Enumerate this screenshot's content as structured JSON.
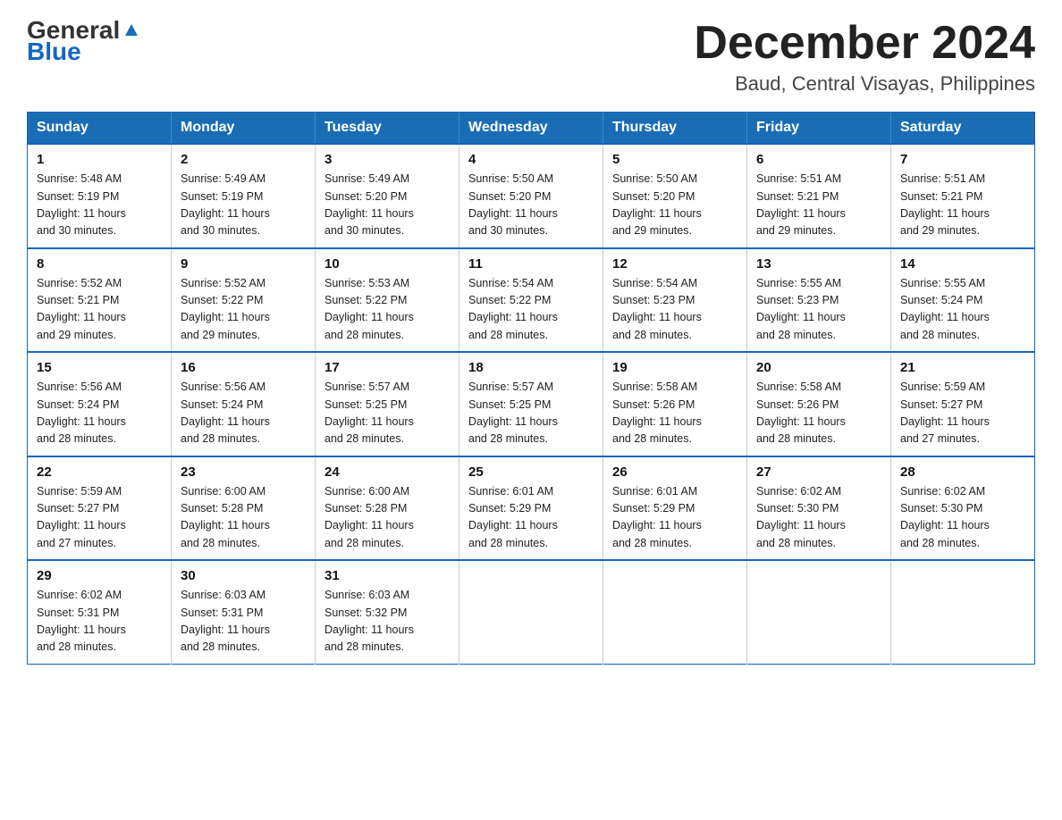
{
  "header": {
    "logo_general": "General",
    "logo_blue": "Blue",
    "month_title": "December 2024",
    "location": "Baud, Central Visayas, Philippines"
  },
  "days_of_week": [
    "Sunday",
    "Monday",
    "Tuesday",
    "Wednesday",
    "Thursday",
    "Friday",
    "Saturday"
  ],
  "weeks": [
    [
      {
        "day": "1",
        "sunrise": "5:48 AM",
        "sunset": "5:19 PM",
        "daylight": "11 hours and 30 minutes."
      },
      {
        "day": "2",
        "sunrise": "5:49 AM",
        "sunset": "5:19 PM",
        "daylight": "11 hours and 30 minutes."
      },
      {
        "day": "3",
        "sunrise": "5:49 AM",
        "sunset": "5:20 PM",
        "daylight": "11 hours and 30 minutes."
      },
      {
        "day": "4",
        "sunrise": "5:50 AM",
        "sunset": "5:20 PM",
        "daylight": "11 hours and 30 minutes."
      },
      {
        "day": "5",
        "sunrise": "5:50 AM",
        "sunset": "5:20 PM",
        "daylight": "11 hours and 29 minutes."
      },
      {
        "day": "6",
        "sunrise": "5:51 AM",
        "sunset": "5:21 PM",
        "daylight": "11 hours and 29 minutes."
      },
      {
        "day": "7",
        "sunrise": "5:51 AM",
        "sunset": "5:21 PM",
        "daylight": "11 hours and 29 minutes."
      }
    ],
    [
      {
        "day": "8",
        "sunrise": "5:52 AM",
        "sunset": "5:21 PM",
        "daylight": "11 hours and 29 minutes."
      },
      {
        "day": "9",
        "sunrise": "5:52 AM",
        "sunset": "5:22 PM",
        "daylight": "11 hours and 29 minutes."
      },
      {
        "day": "10",
        "sunrise": "5:53 AM",
        "sunset": "5:22 PM",
        "daylight": "11 hours and 28 minutes."
      },
      {
        "day": "11",
        "sunrise": "5:54 AM",
        "sunset": "5:22 PM",
        "daylight": "11 hours and 28 minutes."
      },
      {
        "day": "12",
        "sunrise": "5:54 AM",
        "sunset": "5:23 PM",
        "daylight": "11 hours and 28 minutes."
      },
      {
        "day": "13",
        "sunrise": "5:55 AM",
        "sunset": "5:23 PM",
        "daylight": "11 hours and 28 minutes."
      },
      {
        "day": "14",
        "sunrise": "5:55 AM",
        "sunset": "5:24 PM",
        "daylight": "11 hours and 28 minutes."
      }
    ],
    [
      {
        "day": "15",
        "sunrise": "5:56 AM",
        "sunset": "5:24 PM",
        "daylight": "11 hours and 28 minutes."
      },
      {
        "day": "16",
        "sunrise": "5:56 AM",
        "sunset": "5:24 PM",
        "daylight": "11 hours and 28 minutes."
      },
      {
        "day": "17",
        "sunrise": "5:57 AM",
        "sunset": "5:25 PM",
        "daylight": "11 hours and 28 minutes."
      },
      {
        "day": "18",
        "sunrise": "5:57 AM",
        "sunset": "5:25 PM",
        "daylight": "11 hours and 28 minutes."
      },
      {
        "day": "19",
        "sunrise": "5:58 AM",
        "sunset": "5:26 PM",
        "daylight": "11 hours and 28 minutes."
      },
      {
        "day": "20",
        "sunrise": "5:58 AM",
        "sunset": "5:26 PM",
        "daylight": "11 hours and 28 minutes."
      },
      {
        "day": "21",
        "sunrise": "5:59 AM",
        "sunset": "5:27 PM",
        "daylight": "11 hours and 27 minutes."
      }
    ],
    [
      {
        "day": "22",
        "sunrise": "5:59 AM",
        "sunset": "5:27 PM",
        "daylight": "11 hours and 27 minutes."
      },
      {
        "day": "23",
        "sunrise": "6:00 AM",
        "sunset": "5:28 PM",
        "daylight": "11 hours and 28 minutes."
      },
      {
        "day": "24",
        "sunrise": "6:00 AM",
        "sunset": "5:28 PM",
        "daylight": "11 hours and 28 minutes."
      },
      {
        "day": "25",
        "sunrise": "6:01 AM",
        "sunset": "5:29 PM",
        "daylight": "11 hours and 28 minutes."
      },
      {
        "day": "26",
        "sunrise": "6:01 AM",
        "sunset": "5:29 PM",
        "daylight": "11 hours and 28 minutes."
      },
      {
        "day": "27",
        "sunrise": "6:02 AM",
        "sunset": "5:30 PM",
        "daylight": "11 hours and 28 minutes."
      },
      {
        "day": "28",
        "sunrise": "6:02 AM",
        "sunset": "5:30 PM",
        "daylight": "11 hours and 28 minutes."
      }
    ],
    [
      {
        "day": "29",
        "sunrise": "6:02 AM",
        "sunset": "5:31 PM",
        "daylight": "11 hours and 28 minutes."
      },
      {
        "day": "30",
        "sunrise": "6:03 AM",
        "sunset": "5:31 PM",
        "daylight": "11 hours and 28 minutes."
      },
      {
        "day": "31",
        "sunrise": "6:03 AM",
        "sunset": "5:32 PM",
        "daylight": "11 hours and 28 minutes."
      },
      null,
      null,
      null,
      null
    ]
  ],
  "labels": {
    "sunrise": "Sunrise:",
    "sunset": "Sunset:",
    "daylight": "Daylight:"
  }
}
